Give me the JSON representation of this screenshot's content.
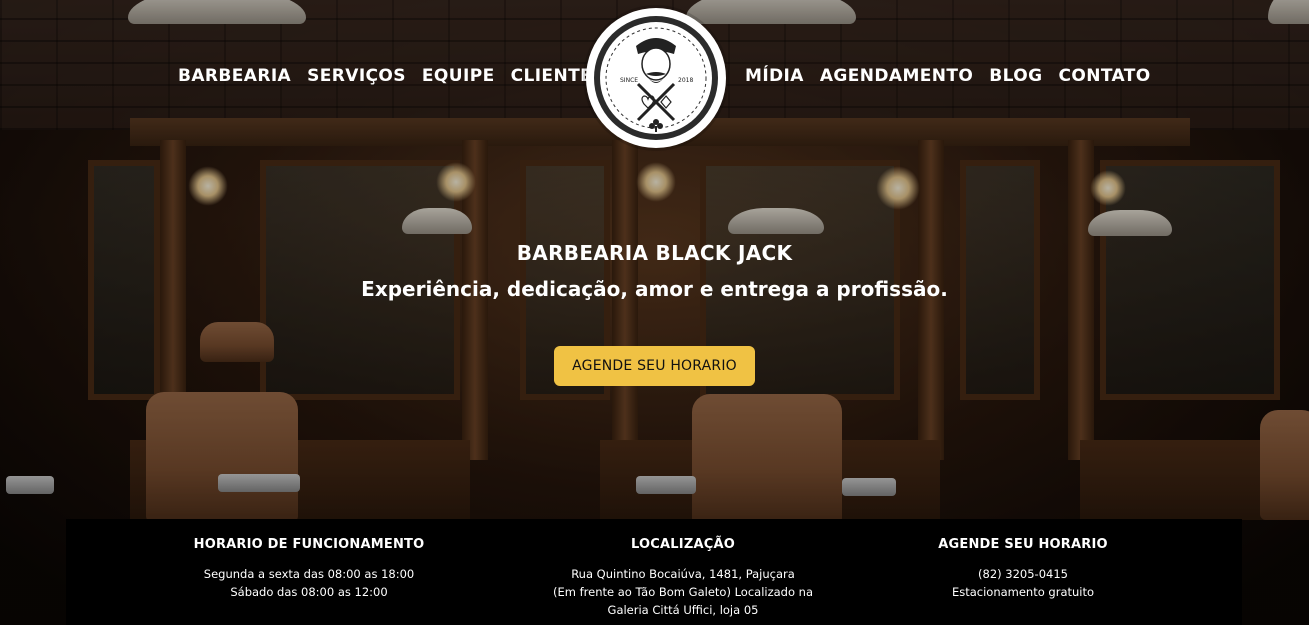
{
  "nav": {
    "left": [
      "BARBEARIA",
      "SERVIÇOS",
      "EQUIPE",
      "CLIENTES"
    ],
    "right": [
      "MÍDIA",
      "AGENDAMENTO",
      "BLOG",
      "CONTATO"
    ]
  },
  "logo": {
    "left_text": "SINCE",
    "right_text": "2018"
  },
  "hero": {
    "title": "BARBEARIA BLACK JACK",
    "subtitle": "Experiência, dedicação, amor e entrega a profissão.",
    "cta_label": "AGENDE SEU HORARIO",
    "cta_color": "#f0c244"
  },
  "info": {
    "hours": {
      "title": "HORARIO DE FUNCIONAMENTO",
      "lines": [
        "Segunda a sexta das 08:00 as 18:00",
        "Sábado das 08:00 as 12:00"
      ]
    },
    "location": {
      "title": "LOCALIZAÇÃO",
      "lines": [
        "Rua Quintino Bocaiúva, 1481, Pajuçara",
        "(Em frente ao Tão Bom Galeto) Localizado na",
        "Galeria Cittá Uffici, loja 05"
      ]
    },
    "schedule": {
      "title": "AGENDE SEU HORARIO",
      "lines": [
        "(82) 3205-0415",
        "Estacionamento gratuito"
      ]
    }
  }
}
